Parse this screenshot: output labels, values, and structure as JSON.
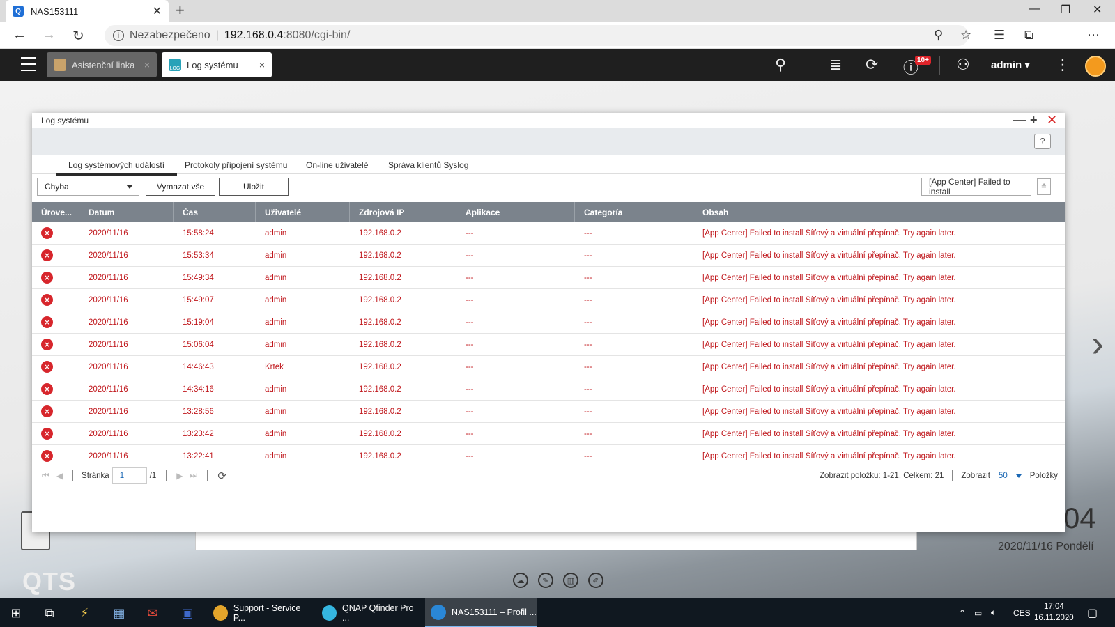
{
  "browser": {
    "tab_title": "NAS153111",
    "tab_favicon": "Q",
    "new_tab": "+",
    "url_unsafe": "Nezabezpečeno",
    "url_sep": "|",
    "url_host": "192.168.0.4",
    "url_path": ":8080/cgi-bin/",
    "window_controls": [
      "—",
      "❐",
      "✕"
    ]
  },
  "qts_bar": {
    "tabs": [
      {
        "label": "Asistenční linka",
        "close": "×",
        "active": false
      },
      {
        "label": "Log systému",
        "close": "×",
        "active": true,
        "icon_text": "LOG"
      }
    ],
    "badge": "10+",
    "user": "admin ▾"
  },
  "window": {
    "title": "Log systému",
    "help": "?",
    "subtabs": [
      "Log systémových událostí",
      "Protokoly připojení systému",
      "On-line uživatelé",
      "Správa klientů Syslog"
    ],
    "filter": {
      "level": "Chyba",
      "clear_all": "Vymazat vše",
      "save": "Uložit",
      "search_value": "[App Center] Failed to install",
      "search_dropdown": "≚"
    },
    "columns": [
      "Úrove...",
      "Datum",
      "Čas",
      "Uživatelé",
      "Zdrojová IP",
      "Aplikace",
      "Categoría",
      "Obsah"
    ],
    "rows": [
      {
        "date": "2020/11/16",
        "time": "15:58:24",
        "user": "admin",
        "ip": "192.168.0.2",
        "app": "---",
        "cat": "---",
        "content": "[App Center] Failed to install Síťový a virtuální přepínač. Try again later."
      },
      {
        "date": "2020/11/16",
        "time": "15:53:34",
        "user": "admin",
        "ip": "192.168.0.2",
        "app": "---",
        "cat": "---",
        "content": "[App Center] Failed to install Síťový a virtuální přepínač. Try again later."
      },
      {
        "date": "2020/11/16",
        "time": "15:49:34",
        "user": "admin",
        "ip": "192.168.0.2",
        "app": "---",
        "cat": "---",
        "content": "[App Center] Failed to install Síťový a virtuální přepínač. Try again later."
      },
      {
        "date": "2020/11/16",
        "time": "15:49:07",
        "user": "admin",
        "ip": "192.168.0.2",
        "app": "---",
        "cat": "---",
        "content": "[App Center] Failed to install Síťový a virtuální přepínač. Try again later."
      },
      {
        "date": "2020/11/16",
        "time": "15:19:04",
        "user": "admin",
        "ip": "192.168.0.2",
        "app": "---",
        "cat": "---",
        "content": "[App Center] Failed to install Síťový a virtuální přepínač. Try again later."
      },
      {
        "date": "2020/11/16",
        "time": "15:06:04",
        "user": "admin",
        "ip": "192.168.0.2",
        "app": "---",
        "cat": "---",
        "content": "[App Center] Failed to install Síťový a virtuální přepínač. Try again later."
      },
      {
        "date": "2020/11/16",
        "time": "14:46:43",
        "user": "Krtek",
        "ip": "192.168.0.2",
        "app": "---",
        "cat": "---",
        "content": "[App Center] Failed to install Síťový a virtuální přepínač. Try again later."
      },
      {
        "date": "2020/11/16",
        "time": "14:34:16",
        "user": "admin",
        "ip": "192.168.0.2",
        "app": "---",
        "cat": "---",
        "content": "[App Center] Failed to install Síťový a virtuální přepínač. Try again later."
      },
      {
        "date": "2020/11/16",
        "time": "13:28:56",
        "user": "admin",
        "ip": "192.168.0.2",
        "app": "---",
        "cat": "---",
        "content": "[App Center] Failed to install Síťový a virtuální přepínač. Try again later."
      },
      {
        "date": "2020/11/16",
        "time": "13:23:42",
        "user": "admin",
        "ip": "192.168.0.2",
        "app": "---",
        "cat": "---",
        "content": "[App Center] Failed to install Síťový a virtuální přepínač. Try again later."
      },
      {
        "date": "2020/11/16",
        "time": "13:22:41",
        "user": "admin",
        "ip": "192.168.0.2",
        "app": "---",
        "cat": "---",
        "content": "[App Center] Failed to install Síťový a virtuální přepínač. Try again later."
      }
    ],
    "pager": {
      "page_label": "Stránka",
      "page_value": "1",
      "page_total": "/1",
      "showing": "Zobrazit položku: 1-21, Celkem: 21",
      "show_label": "Zobrazit",
      "per_page": "50",
      "items_label": "Položky"
    }
  },
  "desktop": {
    "clock_partial": "04",
    "date": "2020/11/16 Pondělí",
    "logo": "QTS"
  },
  "taskbar": {
    "apps": [
      {
        "label": "Support - Service P...",
        "color": "#e4a52b"
      },
      {
        "label": "QNAP Qfinder Pro ...",
        "color": "#35b6e0"
      },
      {
        "label": "NAS153111 – Profil ...",
        "color": "#2a87d6"
      }
    ],
    "lang": "CES",
    "time": "17:04",
    "date": "16.11.2020"
  },
  "colors": {
    "error_red": "#c0171c",
    "header_gray": "#7b838c",
    "qts_bar": "#1f1f1f",
    "accent_blue": "#1b68b4"
  }
}
